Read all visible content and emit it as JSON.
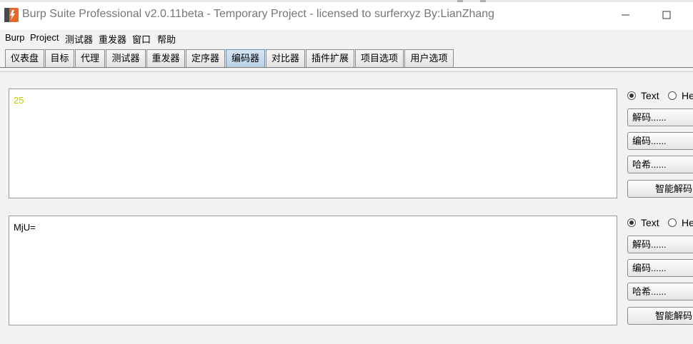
{
  "window": {
    "title": "Burp Suite Professional v2.0.11beta - Temporary Project - licensed to surferxyz By:LianZhang",
    "brand_color": "#e8682b"
  },
  "menubar": {
    "items": [
      {
        "label": "Burp"
      },
      {
        "label": "Project"
      },
      {
        "label": "测试器"
      },
      {
        "label": "重发器"
      },
      {
        "label": "窗口"
      },
      {
        "label": "帮助"
      }
    ]
  },
  "tabs": [
    {
      "label": "仪表盘",
      "active": false
    },
    {
      "label": "目标",
      "active": false
    },
    {
      "label": "代理",
      "active": false
    },
    {
      "label": "测试器",
      "active": false
    },
    {
      "label": "重发器",
      "active": false
    },
    {
      "label": "定序器",
      "active": false
    },
    {
      "label": "编码器",
      "active": true
    },
    {
      "label": "对比器",
      "active": false
    },
    {
      "label": "插件扩展",
      "active": false
    },
    {
      "label": "项目选项",
      "active": false
    },
    {
      "label": "用户选项",
      "active": false
    }
  ],
  "panels": [
    {
      "content": "25",
      "content_color": "#c8c800",
      "mode_options": [
        {
          "label": "Text",
          "checked": true
        },
        {
          "label": "He",
          "checked": false
        }
      ],
      "buttons": {
        "decode": "解码......",
        "encode": "编码......",
        "hash": "哈希......",
        "smart_decode": "智能解码"
      }
    },
    {
      "content": "MjU=",
      "content_color": "#000000",
      "mode_options": [
        {
          "label": "Text",
          "checked": true
        },
        {
          "label": "He",
          "checked": false
        }
      ],
      "buttons": {
        "decode": "解码......",
        "encode": "编码......",
        "hash": "哈希......",
        "smart_decode": "智能解码"
      }
    }
  ]
}
